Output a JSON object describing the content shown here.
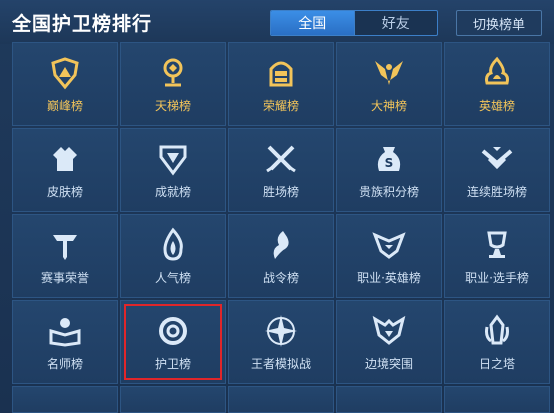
{
  "header": {
    "title": "全国护卫榜排行",
    "tabs": [
      {
        "label": "全国",
        "active": true
      },
      {
        "label": "好友",
        "active": false
      }
    ],
    "switch_button": "切换榜单"
  },
  "tiles": [
    {
      "label": "巅峰榜",
      "icon": "peak-icon",
      "style": "gold"
    },
    {
      "label": "天梯榜",
      "icon": "ladder-icon",
      "style": "gold"
    },
    {
      "label": "荣耀榜",
      "icon": "glory-helmet-icon",
      "style": "gold"
    },
    {
      "label": "大神榜",
      "icon": "master-wings-icon",
      "style": "gold"
    },
    {
      "label": "英雄榜",
      "icon": "hero-flame-icon",
      "style": "gold"
    },
    {
      "label": "皮肤榜",
      "icon": "skin-shirt-icon",
      "style": "normal"
    },
    {
      "label": "成就榜",
      "icon": "achievement-icon",
      "style": "normal"
    },
    {
      "label": "胜场榜",
      "icon": "crossed-swords-icon",
      "style": "normal"
    },
    {
      "label": "贵族积分榜",
      "icon": "noble-bag-icon",
      "style": "normal"
    },
    {
      "label": "连续胜场榜",
      "icon": "winstreak-chevron-icon",
      "style": "normal"
    },
    {
      "label": "赛事荣誉",
      "icon": "tournament-sword-icon",
      "style": "normal"
    },
    {
      "label": "人气榜",
      "icon": "popularity-flame-icon",
      "style": "normal"
    },
    {
      "label": "战令榜",
      "icon": "battle-pass-icon",
      "style": "normal"
    },
    {
      "label": "职业·英雄榜",
      "icon": "pro-hero-icon",
      "style": "normal"
    },
    {
      "label": "职业·选手榜",
      "icon": "pro-player-trophy-icon",
      "style": "normal"
    },
    {
      "label": "名师榜",
      "icon": "mentor-book-icon",
      "style": "normal"
    },
    {
      "label": "护卫榜",
      "icon": "guardian-ring-icon",
      "style": "normal",
      "selected": true
    },
    {
      "label": "王者模拟战",
      "icon": "auto-chess-star-icon",
      "style": "normal"
    },
    {
      "label": "边境突围",
      "icon": "border-breakout-icon",
      "style": "normal"
    },
    {
      "label": "日之塔",
      "icon": "sun-tower-icon",
      "style": "normal"
    }
  ],
  "colors": {
    "gold": "#f2c45a",
    "light_blue": "#cfe0f3",
    "selection": "#e0262a",
    "accent": "#3b8ee6"
  }
}
